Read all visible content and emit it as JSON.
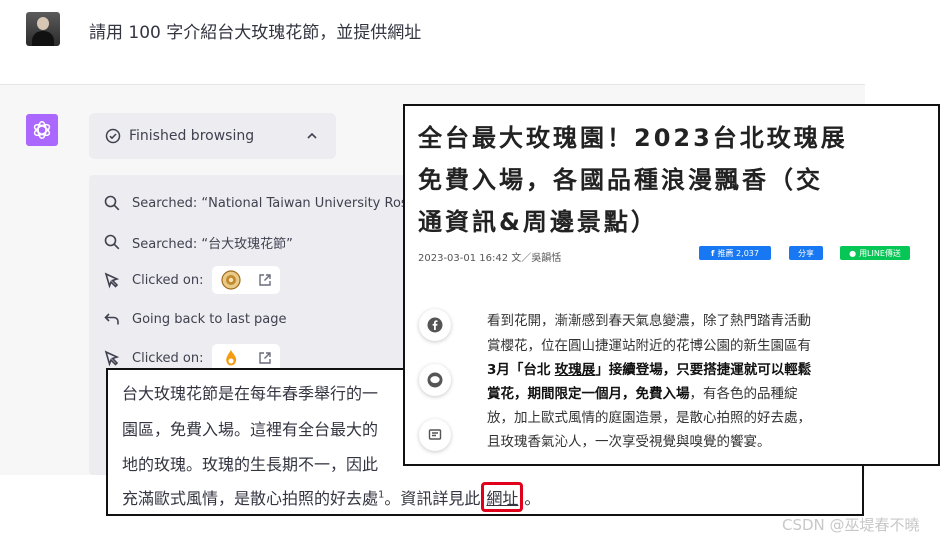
{
  "user_message": {
    "text": "請用 100 字介紹台大玫瑰花節，並提供網址"
  },
  "browsing": {
    "status_label": "Finished browsing",
    "steps": [
      {
        "icon": "search-icon",
        "text": "Searched: “National Taiwan University Rose Festival”"
      },
      {
        "icon": "search-icon",
        "text": "Searched: “台大玫瑰花節”"
      },
      {
        "icon": "cursor-icon",
        "text": "Clicked on:"
      },
      {
        "icon": "back-arrow-icon",
        "text": "Going back to last page"
      },
      {
        "icon": "cursor-icon",
        "text": "Clicked on:"
      }
    ]
  },
  "answer": {
    "line1": "台大玫瑰花節是在每年春季舉行的一",
    "line2": "園區，免費入場。這裡有全台最大的",
    "line3": "地的玫瑰。玫瑰的生長期不一，因此",
    "line4_before": "充滿歐式風情，是散心拍照的好去處",
    "footnote": "1",
    "line4_mid": "。資訊詳見此",
    "link_text": "網址",
    "line4_after": "。"
  },
  "article": {
    "title_line1": "全台最大玫瑰園！2023台北玫瑰展",
    "title_line2": "免費入場，各國品種浪漫飄香（交",
    "title_line3": "通資訊&周邊景點）",
    "meta": "2023-03-01 16:42 文／吳韻恬",
    "fb_button": "推薦 2,037",
    "share_button": "分享",
    "line_button": "用LINE傳送",
    "body_line1": "看到花開，漸漸感到春天氣息變濃，除了熱門踏青活動",
    "body_line2": "賞櫻花，位在圓山捷運站附近的花博公園的新生園區有",
    "body_line3_a": "3月「台北",
    "body_line3_b": "玫瑰展",
    "body_line3_c": "」接續登場，只要搭捷運就可以輕鬆",
    "body_line4_bold": "賞花，期間限定一個月，免費入場",
    "body_line4_rest": "，有各色的品種綻",
    "body_line5": "放，加上歐式風情的庭園造景，是散心拍照的好去處，",
    "body_line6": "且玫瑰香氣沁人，一次享受視覺與嗅覺的饗宴。"
  },
  "watermark": "CSDN @巫堤春不曉",
  "colors": {
    "assistant_bg": "#f7f7f8",
    "gpt_purple": "#ab68ff",
    "link_highlight": "#e0001b",
    "facebook_blue": "#1877f2",
    "line_green": "#06c755"
  }
}
